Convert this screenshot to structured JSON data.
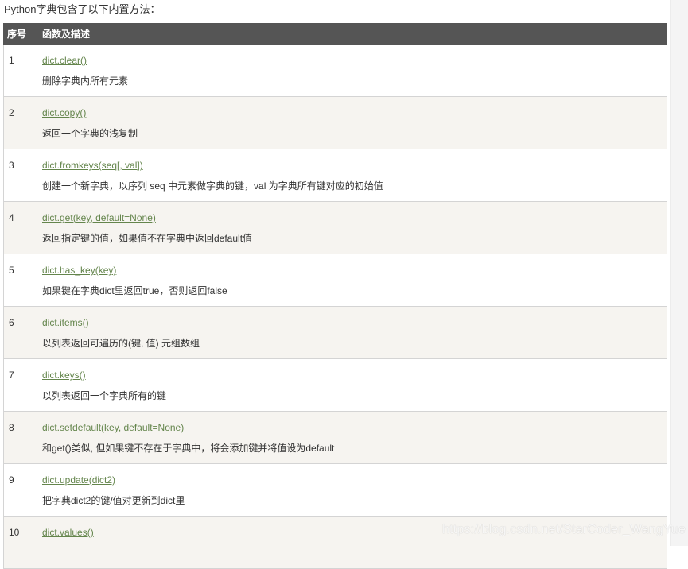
{
  "intro": "Python字典包含了以下内置方法：",
  "table": {
    "headers": [
      "序号",
      "函数及描述"
    ],
    "rows": [
      {
        "num": "1",
        "fn": "dict.clear()",
        "desc": "删除字典内所有元素"
      },
      {
        "num": "2",
        "fn": "dict.copy()",
        "desc": "返回一个字典的浅复制"
      },
      {
        "num": "3",
        "fn": "dict.fromkeys(seq[, val])",
        "desc": "创建一个新字典，以序列 seq 中元素做字典的键，val 为字典所有键对应的初始值"
      },
      {
        "num": "4",
        "fn": "dict.get(key, default=None)",
        "desc": "返回指定键的值，如果值不在字典中返回default值"
      },
      {
        "num": "5",
        "fn": "dict.has_key(key)",
        "desc": "如果键在字典dict里返回true，否则返回false"
      },
      {
        "num": "6",
        "fn": "dict.items()",
        "desc": "以列表返回可遍历的(键, 值) 元组数组"
      },
      {
        "num": "7",
        "fn": "dict.keys()",
        "desc": "以列表返回一个字典所有的键"
      },
      {
        "num": "8",
        "fn": "dict.setdefault(key, default=None)",
        "desc": "和get()类似, 但如果键不存在于字典中，将会添加键并将值设为default"
      },
      {
        "num": "9",
        "fn": "dict.update(dict2)",
        "desc": "把字典dict2的键/值对更新到dict里"
      },
      {
        "num": "10",
        "fn": "dict.values()",
        "desc": ""
      }
    ]
  },
  "watermark": "https://blog.csdn.net/StarCoder_WangYue",
  "colors": {
    "header_bg": "#555555",
    "link": "#64854c",
    "row_alt": "#f6f4f0",
    "border": "#d4d4d4"
  }
}
